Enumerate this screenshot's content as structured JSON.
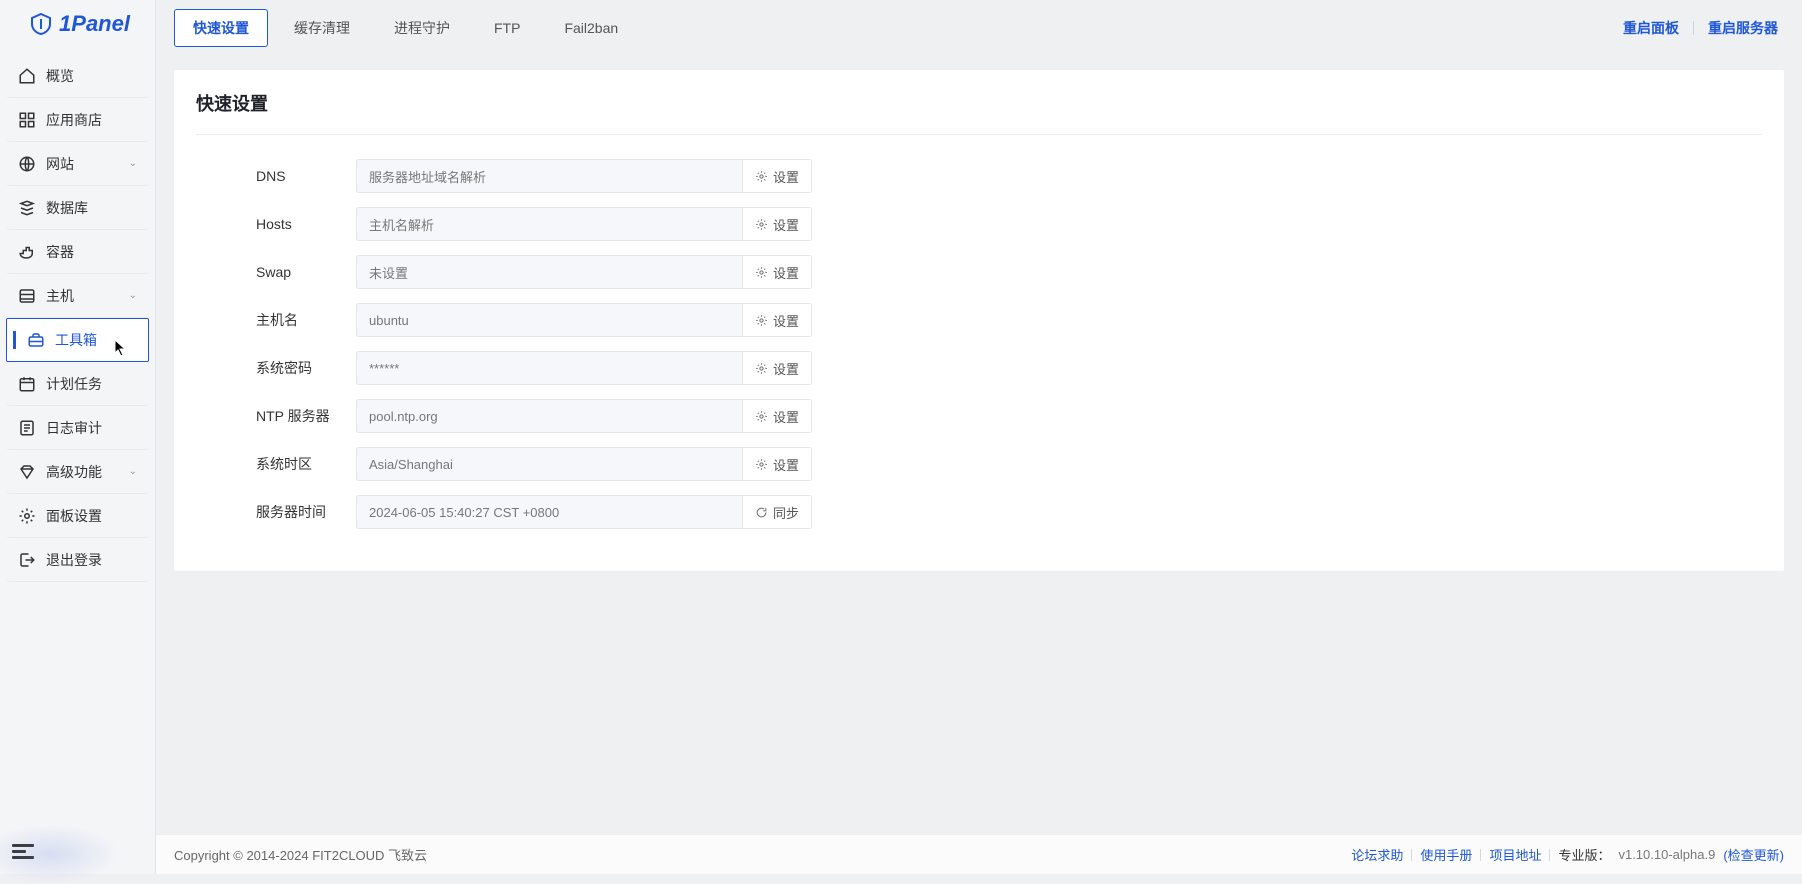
{
  "brand": "1Panel",
  "sidebar": {
    "items": [
      {
        "label": "概览"
      },
      {
        "label": "应用商店"
      },
      {
        "label": "网站",
        "expandable": true
      },
      {
        "label": "数据库"
      },
      {
        "label": "容器"
      },
      {
        "label": "主机",
        "expandable": true
      },
      {
        "label": "工具箱",
        "active": true
      },
      {
        "label": "计划任务"
      },
      {
        "label": "日志审计"
      },
      {
        "label": "高级功能",
        "expandable": true
      },
      {
        "label": "面板设置"
      },
      {
        "label": "退出登录"
      }
    ]
  },
  "tabs": [
    {
      "label": "快速设置",
      "active": true
    },
    {
      "label": "缓存清理"
    },
    {
      "label": "进程守护"
    },
    {
      "label": "FTP"
    },
    {
      "label": "Fail2ban"
    }
  ],
  "header_actions": {
    "restart_panel": "重启面板",
    "restart_server": "重启服务器"
  },
  "page": {
    "title": "快速设置",
    "settings_btn": "设置",
    "sync_btn": "同步",
    "rows": {
      "dns": {
        "label": "DNS",
        "value": "服务器地址域名解析"
      },
      "hosts": {
        "label": "Hosts",
        "value": "主机名解析"
      },
      "swap": {
        "label": "Swap",
        "value": "未设置"
      },
      "hostname": {
        "label": "主机名",
        "value": "ubuntu"
      },
      "password": {
        "label": "系统密码",
        "value": "******"
      },
      "ntp": {
        "label": "NTP 服务器",
        "value": "pool.ntp.org"
      },
      "timezone": {
        "label": "系统时区",
        "value": "Asia/Shanghai"
      },
      "time": {
        "label": "服务器时间",
        "value": "2024-06-05 15:40:27 CST +0800"
      }
    }
  },
  "footer": {
    "copyright": "Copyright © 2014-2024 FIT2CLOUD 飞致云",
    "links": {
      "forum": "论坛求助",
      "manual": "使用手册",
      "project": "项目地址"
    },
    "version_label": "专业版：",
    "version_value": "v1.10.10-alpha.9",
    "check_update": "(检查更新)"
  }
}
